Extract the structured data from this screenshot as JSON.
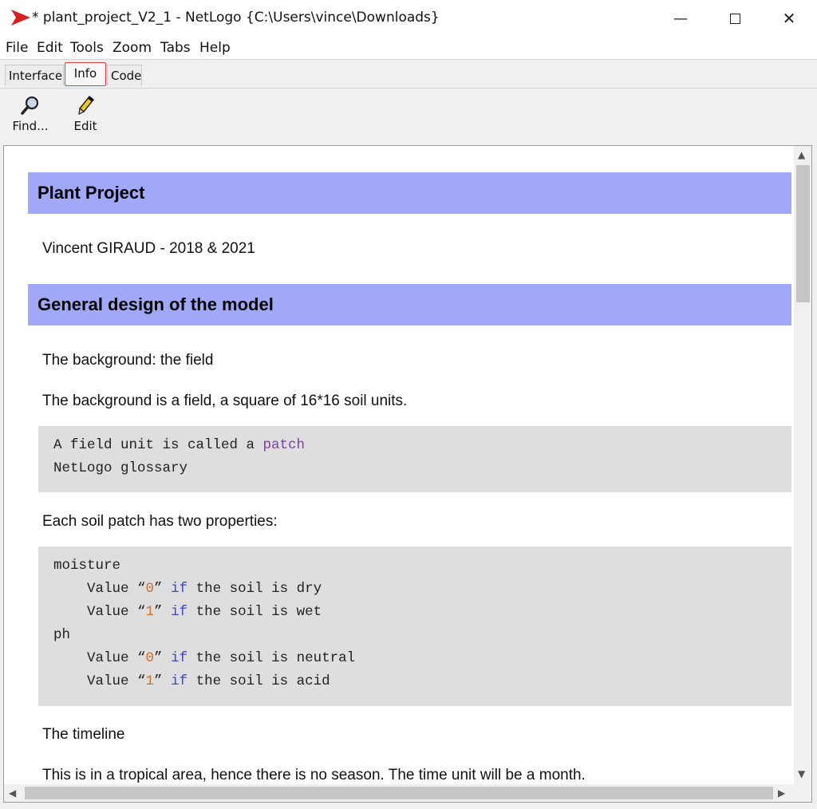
{
  "window": {
    "title": "* plant_project_V2_1 - NetLogo {C:\\Users\\vince\\Downloads}",
    "min_icon": "minimize-icon",
    "max_icon": "maximize-icon",
    "close_icon": "close-icon",
    "close_glyph": "✕",
    "min_glyph": "—"
  },
  "menu": {
    "items": [
      "File",
      "Edit",
      "Tools",
      "Zoom",
      "Tabs",
      "Help"
    ]
  },
  "tabs": [
    {
      "label": "Interface",
      "active": false
    },
    {
      "label": "Info",
      "active": true
    },
    {
      "label": "Code",
      "active": false
    }
  ],
  "toolbar": {
    "find_label": "Find...",
    "edit_label": "Edit"
  },
  "info": {
    "heading1": "Plant Project",
    "author": "Vincent GIRAUD - 2018 & 2021",
    "heading2": "General design of the model",
    "p_background_title": "The background: the field",
    "p_background_desc": "The background is a field, a square of 16*16 soil units.",
    "code1": {
      "line1_text": "A field unit is called a ",
      "line1_kw": "patch",
      "line2": "NetLogo glossary"
    },
    "p_properties": "Each soil patch has two properties:",
    "code2": {
      "moisture": "moisture",
      "ph": "ph",
      "value_prefix": "    Value “",
      "v0": "0",
      "v1": "1",
      "quote_close": "” ",
      "if_kw": "if",
      "dry": " the soil is dry",
      "wet": " the soil is wet",
      "neutral": " the soil is neutral",
      "acid": " the soil is acid"
    },
    "p_timeline_title": "The timeline",
    "p_timeline_desc": "This is in a tropical area, hence there is no season. The time unit will be a month."
  },
  "colors": {
    "heading_bg": "#a2a8f8",
    "code_bg": "#dedede",
    "active_tab_border": "#e04040"
  }
}
